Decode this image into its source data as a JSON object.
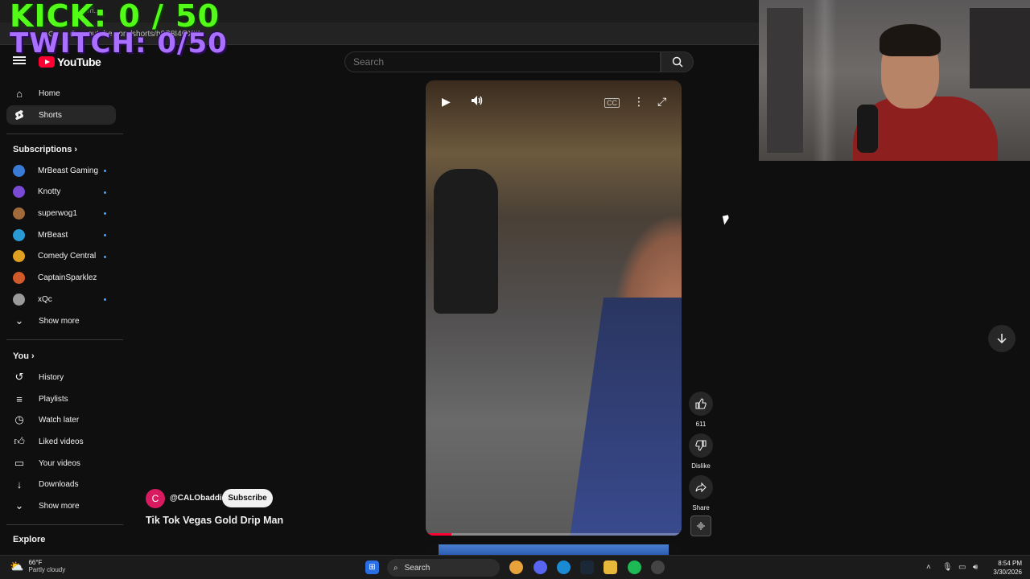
{
  "overlay": {
    "kick": "KICK: 0 / 50",
    "twitch": "TWITCH: 0/50"
  },
  "browser": {
    "tab_title": "...d Dri...",
    "url": "youtube.com/shorts/h0S8I4OXttI"
  },
  "header": {
    "logo_text": "YouTube",
    "search_placeholder": "Search"
  },
  "sidebar": {
    "main": [
      {
        "label": "Home",
        "icon": "home-icon"
      },
      {
        "label": "Shorts",
        "icon": "shorts-icon",
        "active": true
      }
    ],
    "subscriptions_title": "Subscriptions",
    "subscriptions": [
      {
        "label": "MrBeast Gaming",
        "color": "#3a7bd5",
        "live": true
      },
      {
        "label": "Knotty",
        "color": "#7b4ad5",
        "live": true
      },
      {
        "label": "superwog1",
        "color": "#a06a3a",
        "live": true
      },
      {
        "label": "MrBeast",
        "color": "#2a9ad5",
        "live": true
      },
      {
        "label": "Comedy Central",
        "color": "#e0a020",
        "live": true
      },
      {
        "label": "CaptainSparklez",
        "color": "#d05a2a",
        "live": false
      },
      {
        "label": "xQc",
        "color": "#9a9a9a",
        "live": true
      }
    ],
    "show_more": "Show more",
    "you_title": "You",
    "you": [
      {
        "label": "History",
        "icon": "history-icon"
      },
      {
        "label": "Playlists",
        "icon": "playlists-icon"
      },
      {
        "label": "Watch later",
        "icon": "watch-later-icon"
      },
      {
        "label": "Liked videos",
        "icon": "liked-videos-icon"
      },
      {
        "label": "Your videos",
        "icon": "your-videos-icon"
      },
      {
        "label": "Downloads",
        "icon": "downloads-icon"
      }
    ],
    "show_more_2": "Show more",
    "explore_title": "Explore"
  },
  "video": {
    "channel_initial": "C",
    "channel": "@CALObaddie",
    "subscribe_label": "Subscribe",
    "title": "Tik Tok Vegas Gold Drip Man",
    "progress": 0.1
  },
  "actions": {
    "likes": "611",
    "dislike_label": "Dislike",
    "share_label": "Share"
  },
  "taskbar": {
    "temp": "66°F",
    "weather": "Partly cloudy",
    "search_label": "Search",
    "time": "8:54 PM",
    "date": "3/30/2026"
  },
  "colors": {
    "kick": "#53fc18",
    "twitch": "#a970ff",
    "yt_red": "#ff0033"
  }
}
